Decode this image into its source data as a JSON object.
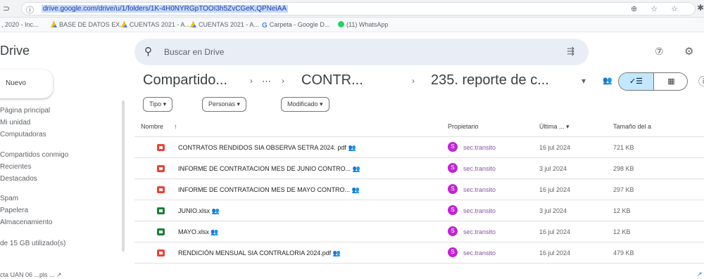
{
  "browser": {
    "back_glyph": "⊃",
    "info_glyph": "ⓘ",
    "url": "drive.google.com/drive/u/1/folders/1K-4H0NYRGpTOOI3h5Z​vCGeK,QPNeiAA",
    "right_icons": "⊕ ☆ ☆",
    "ext_glyph": "✱",
    "bookmarks": [
      {
        "label": ", 2020 - Inc...",
        "icon": "none"
      },
      {
        "label": "BASE DE DATOS EX...",
        "icon": "drive"
      },
      {
        "label": "CUENTAS 2021 - A...",
        "icon": "drive"
      },
      {
        "label": "CUENTAS 2021 - A...",
        "icon": "drive"
      },
      {
        "label": "Carpeta - Google D...",
        "icon": "google"
      },
      {
        "label": "(11) WhatsApp",
        "icon": "whatsapp"
      }
    ]
  },
  "app": {
    "brand": "Drive",
    "search_placeholder": "Buscar en Drive",
    "search_icon": "⚲",
    "filter_icon": "⇶",
    "help_icon": "⑦",
    "settings_icon": "⚙"
  },
  "sidebar": {
    "new_label": "Nuevo",
    "items": [
      "Página principal",
      "Mi unidad",
      "Computadoras",
      "Compartidos conmigo",
      "Recientes",
      "Destacados",
      "Spam",
      "Papelera",
      "Almacenamiento",
      "de 15 GB utilizado(s)"
    ]
  },
  "breadcrumb": {
    "items": [
      "Compartido...",
      "⋯",
      "CONTR...",
      "235. reporte de c..."
    ],
    "separator": "›",
    "dropdown_glyph": "▾",
    "shared_glyph": "👥"
  },
  "view_toggle": {
    "list_label": "✓☰",
    "grid_label": "▦"
  },
  "info_glyph": "ⓘ",
  "filters": [
    "Tipo  ▾",
    "Personas  ▾",
    "Modificado  ▾"
  ],
  "table": {
    "headers": {
      "name": "Nombre",
      "sort": "↑",
      "owner": "Propietario",
      "modified": "Última ... ▾",
      "size": "Tamaño del a"
    },
    "rows": [
      {
        "name": "CONTRATOS RENDIDOS SIA OBSERVA SETRA 2024. pdf",
        "shared": "👥",
        "type": "pdf",
        "owner_initial": "S",
        "owner": "sec.transito",
        "modified": "16 jul 2024",
        "size": "721 KB"
      },
      {
        "name": "INFORME DE CONTRATACION MES DE JUNIO CONTRO...",
        "shared": "👥",
        "type": "pdf",
        "owner_initial": "S",
        "owner": "sec.transito",
        "modified": "3 jul 2024",
        "size": "298 KB"
      },
      {
        "name": "INFORME DE CONTRATACION MES DE MAYO CONTRO...",
        "shared": "👥",
        "type": "pdf",
        "owner_initial": "S",
        "owner": "sec.transito",
        "modified": "16 jul 2024",
        "size": "297 KB"
      },
      {
        "name": "JUNIO.xlsx",
        "shared": "👥",
        "type": "xls",
        "owner_initial": "S",
        "owner": "sec.transito",
        "modified": "3 jul 2024",
        "size": "12 KB"
      },
      {
        "name": "MAYO.xlsx",
        "shared": "👥",
        "type": "xls",
        "owner_initial": "S",
        "owner": "sec.transito",
        "modified": "16 jul 2024",
        "size": "12 KB"
      },
      {
        "name": "RENDICIÓN MENSUAL SIA CONTRALORIA 2024.pdf",
        "shared": "👥",
        "type": "pdf",
        "owner_initial": "S",
        "owner": "sec.transito",
        "modified": "16 jul 2024",
        "size": "479 KB"
      }
    ]
  },
  "footer": {
    "left": "cta UAN 06 ...pls ... ↗",
    "right": "↗"
  }
}
